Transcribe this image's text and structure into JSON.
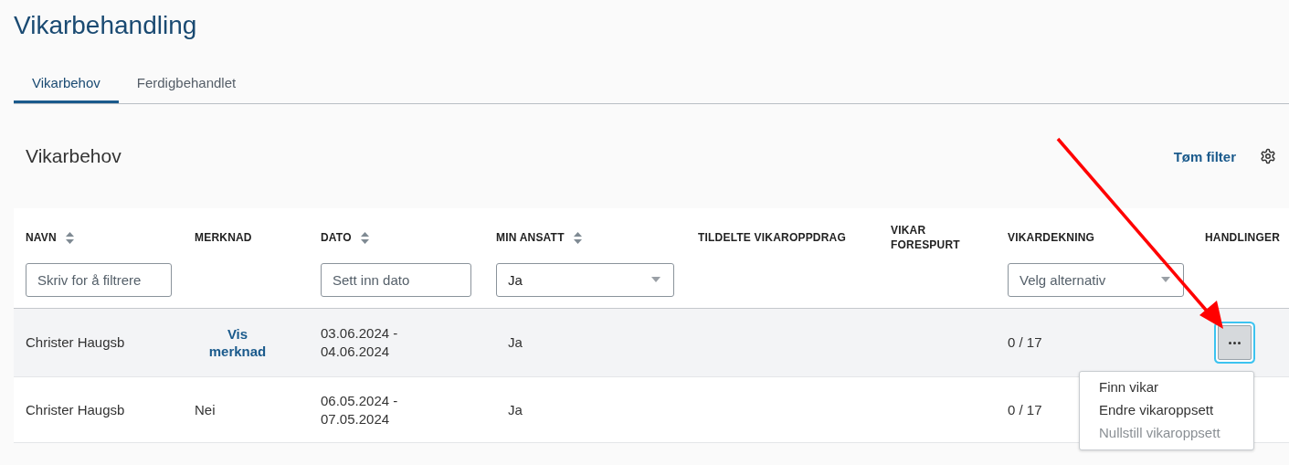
{
  "page_title": "Vikarbehandling",
  "tabs": [
    {
      "label": "Vikarbehov",
      "selected": true
    },
    {
      "label": "Ferdigbehandlet",
      "selected": false
    }
  ],
  "section": {
    "title": "Vikarbehov",
    "clear_filter": "Tøm filter"
  },
  "table": {
    "columns": [
      {
        "label": "NAVN",
        "sortable": true,
        "filter": {
          "kind": "text",
          "placeholder": "Skriv for å filtrere"
        }
      },
      {
        "label": "MERKNAD",
        "sortable": false
      },
      {
        "label": "DATO",
        "sortable": true,
        "filter": {
          "kind": "text",
          "placeholder": "Sett inn dato"
        }
      },
      {
        "label": "MIN ANSATT",
        "sortable": true,
        "filter": {
          "kind": "select",
          "value": "Ja"
        }
      },
      {
        "label": "TILDELTE VIKAROPPDRAG",
        "sortable": false
      },
      {
        "label": "VIKAR FORESPURT",
        "sortable": false
      },
      {
        "label": "VIKARDEKNING",
        "sortable": false,
        "filter": {
          "kind": "select",
          "placeholder": "Velg alternativ"
        }
      },
      {
        "label": "HANDLINGER",
        "sortable": false
      }
    ],
    "rows": [
      {
        "name": "Christer Haugsb",
        "note": {
          "kind": "link",
          "text": "Vis merknad"
        },
        "date": "03.06.2024 - 04.06.2024",
        "my_employee": "Ja",
        "coverage": "0 / 17",
        "highlighted": true,
        "menu_open": true
      },
      {
        "name": "Christer Haugsb",
        "note": {
          "kind": "text",
          "text": "Nei"
        },
        "date": "06.05.2024 - 07.05.2024",
        "my_employee": "Ja",
        "coverage": "0 / 17",
        "highlighted": false,
        "menu_open": false
      }
    ]
  },
  "actions_menu": [
    {
      "label": "Finn vikar",
      "disabled": false
    },
    {
      "label": "Endre vikaroppsett",
      "disabled": false
    },
    {
      "label": "Nullstill vikaroppsett",
      "disabled": true
    }
  ],
  "annotation": {
    "kind": "arrow"
  }
}
